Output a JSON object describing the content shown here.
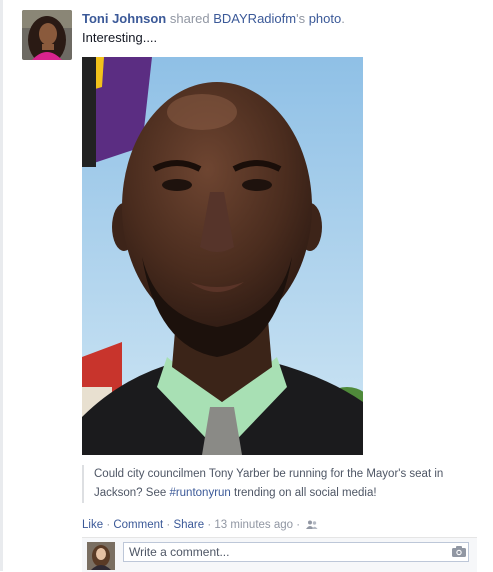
{
  "post": {
    "author": "Toni Johnson",
    "shared_word": "shared",
    "source": "BDAYRadiofm",
    "possessive": "'s",
    "object": "photo",
    "period": ".",
    "status": "Interesting....",
    "caption_part1": "Could city councilmen Tony Yarber be running for the Mayor's seat in Jackson? See ",
    "caption_hashtag": "#runtonyrun",
    "caption_part2": " trending on all social media!"
  },
  "actions": {
    "like": "Like",
    "dot1": "·",
    "comment": "Comment",
    "dot2": "·",
    "share": "Share",
    "dot3": "·",
    "time": "13 minutes ago",
    "dot4": "·"
  },
  "comment_box": {
    "placeholder": "Write a comment..."
  },
  "icons": {
    "audience": "friends-icon",
    "camera": "camera-icon"
  },
  "colors": {
    "link": "#3b5998",
    "muted": "#9197a3",
    "text": "#141823"
  }
}
